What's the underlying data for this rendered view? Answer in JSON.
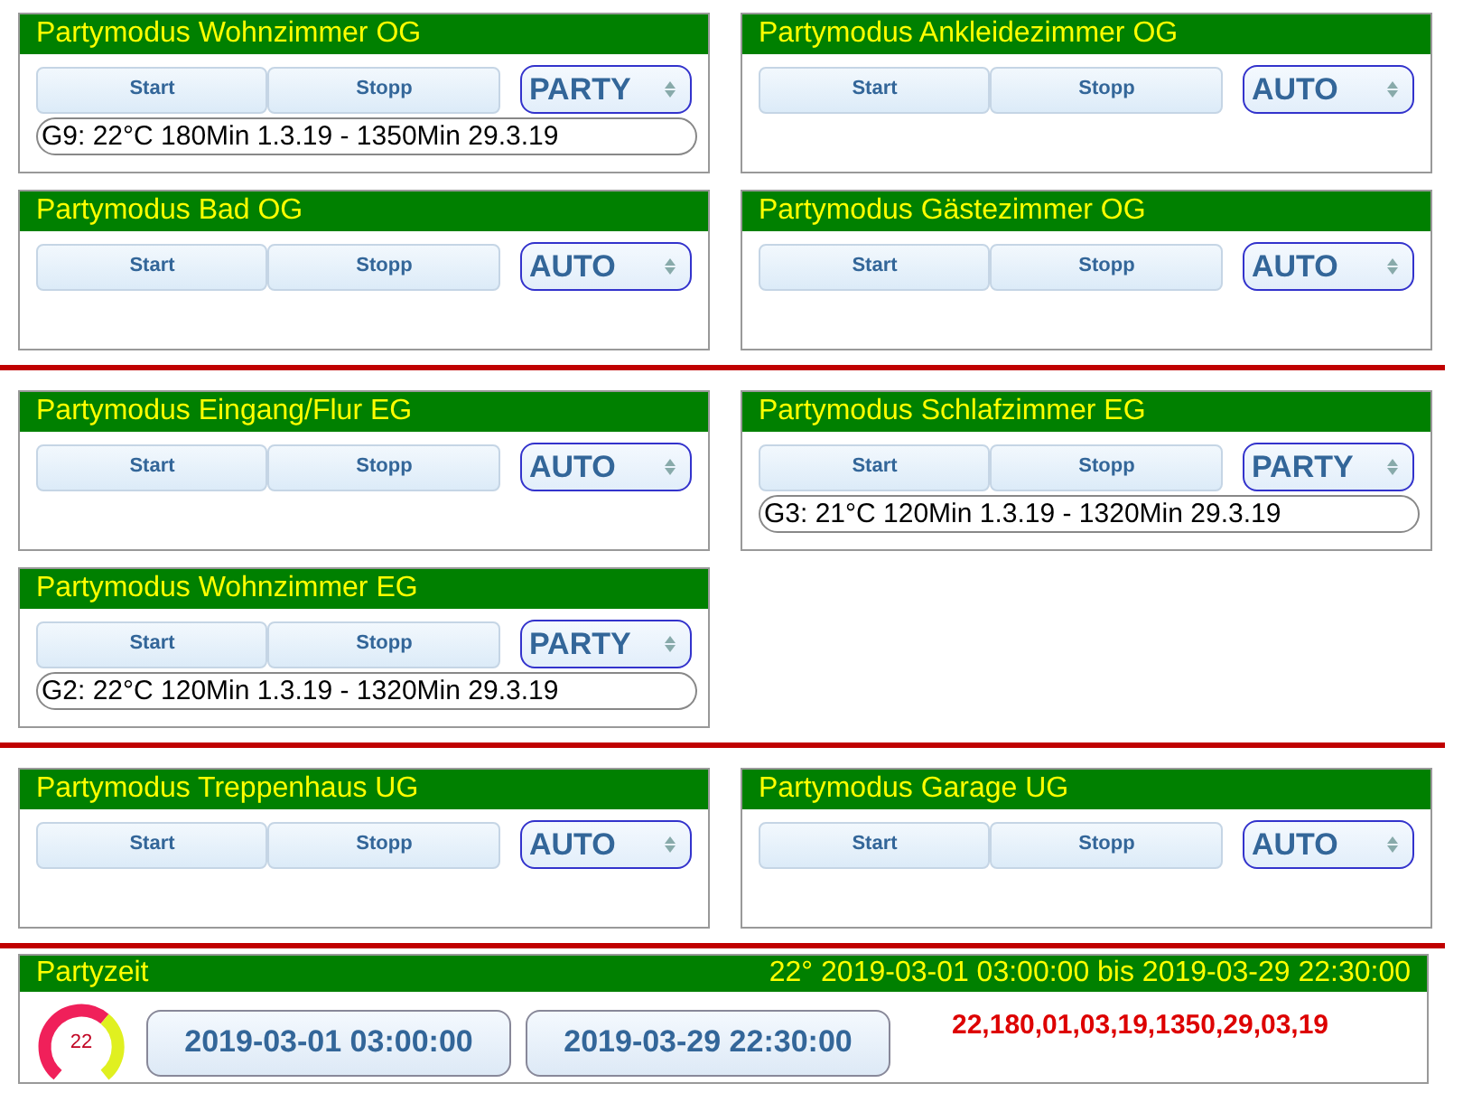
{
  "sections": [
    {
      "cards": [
        {
          "title": "Partymodus Wohnzimmer OG",
          "start": "Start",
          "stop": "Stopp",
          "mode": "PARTY",
          "info": "G9: 22°C 180Min 1.3.19 - 1350Min 29.3.19"
        },
        {
          "title": "Partymodus Ankleidezimmer OG",
          "start": "Start",
          "stop": "Stopp",
          "mode": "AUTO"
        },
        {
          "title": "Partymodus Bad OG",
          "start": "Start",
          "stop": "Stopp",
          "mode": "AUTO"
        },
        {
          "title": "Partymodus Gästezimmer OG",
          "start": "Start",
          "stop": "Stopp",
          "mode": "AUTO"
        }
      ]
    },
    {
      "cards": [
        {
          "title": "Partymodus Eingang/Flur EG",
          "start": "Start",
          "stop": "Stopp",
          "mode": "AUTO"
        },
        {
          "title": "Partymodus Schlafzimmer EG",
          "start": "Start",
          "stop": "Stopp",
          "mode": "PARTY",
          "info": "G3: 21°C 120Min 1.3.19 - 1320Min 29.3.19"
        },
        {
          "title": "Partymodus Wohnzimmer EG",
          "start": "Start",
          "stop": "Stopp",
          "mode": "PARTY",
          "info": "G2: 22°C 120Min 1.3.19 - 1320Min 29.3.19"
        }
      ]
    },
    {
      "cards": [
        {
          "title": "Partymodus Treppenhaus UG",
          "start": "Start",
          "stop": "Stopp",
          "mode": "AUTO"
        },
        {
          "title": "Partymodus Garage UG",
          "start": "Start",
          "stop": "Stopp",
          "mode": "AUTO"
        }
      ]
    }
  ],
  "partyzeit": {
    "title": "Partyzeit",
    "summary": "22° 2019-03-01 03:00:00 bis 2019-03-29 22:30:00",
    "gauge_value": "22",
    "start": "2019-03-01 03:00:00",
    "end": "2019-03-29 22:30:00",
    "code": "22,180,01,03,19,1350,29,03,19"
  }
}
